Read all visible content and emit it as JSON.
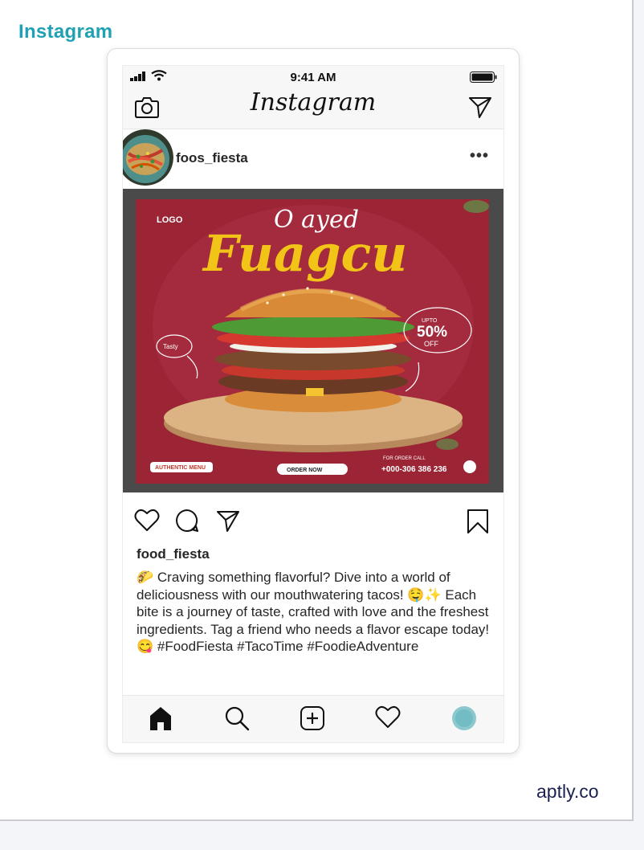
{
  "page": {
    "title": "Instagram",
    "footer_brand": "aptly.co"
  },
  "status_bar": {
    "time": "9:41 AM"
  },
  "app_header": {
    "logo_text": "Instagram",
    "left_icon": "camera-icon",
    "right_icon": "send-icon"
  },
  "post": {
    "account": "foos_fiesta",
    "more_label": "•••",
    "image": {
      "logo": "LOGO",
      "script_text": "O ayed",
      "headline": "Fuagcu",
      "badge_small": "UPTO",
      "badge_percent": "50%",
      "badge_sub": "OFF",
      "bubble_left": "Tasty",
      "pill_left": "AUTHENTIC MENU",
      "pill_center": "ORDER NOW",
      "contact_line1": "FOR ORDER CALL",
      "contact_line2": "+000-306 386 236",
      "bg_color": "#9b2435",
      "frame_color": "#4a4a4a"
    },
    "actions": [
      "heart-icon",
      "comment-icon",
      "share-icon",
      "bookmark-icon"
    ],
    "caption_user": "food_fiesta",
    "caption": "🌮 Craving something flavorful? Dive into a world of deliciousness with our mouthwatering tacos! 🤤✨ Each bite is a journey of taste, crafted with love and the freshest ingredients. Tag a friend who needs a flavor escape today! 😋 #FoodFiesta #TacoTime #FoodieAdventure"
  },
  "tab_bar": {
    "items": [
      "home-icon",
      "search-icon",
      "add-post-icon",
      "activity-heart-icon",
      "profile-avatar"
    ]
  },
  "colors": {
    "brand_teal": "#1fa1b3",
    "footer_navy": "#1b2250",
    "text": "#262626"
  }
}
